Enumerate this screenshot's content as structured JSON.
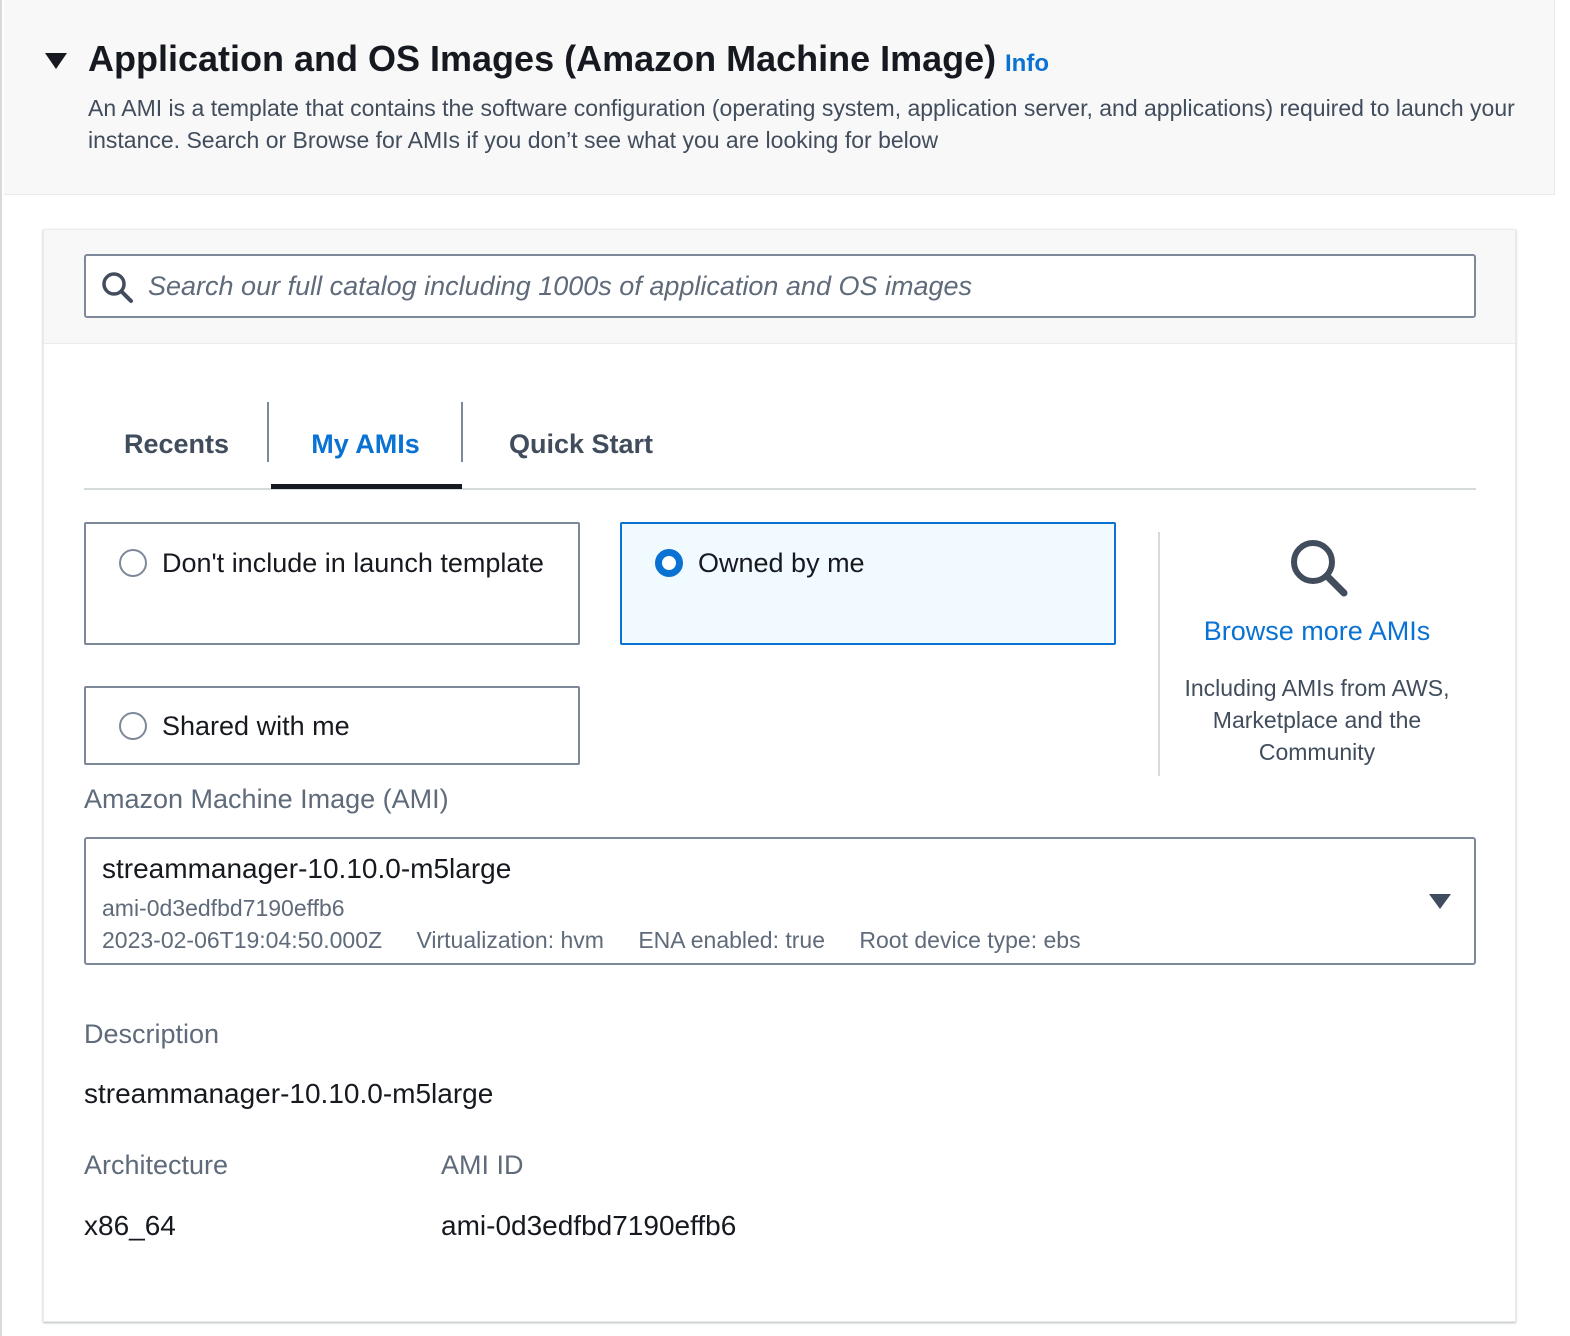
{
  "section": {
    "title": "Application and OS Images (Amazon Machine Image)",
    "info_label": "Info",
    "description": "An AMI is a template that contains the software configuration (operating system, application server, and applications) required to launch your instance. Search or Browse for AMIs if you don’t see what you are looking for below"
  },
  "search": {
    "placeholder": "Search our full catalog including 1000s of application and OS images",
    "value": ""
  },
  "tabs": [
    {
      "label": "Recents",
      "active": false
    },
    {
      "label": "My AMIs",
      "active": true
    },
    {
      "label": "Quick Start",
      "active": false
    }
  ],
  "ownership_options": [
    {
      "label": "Don't include in launch template",
      "checked": false
    },
    {
      "label": "Owned by me",
      "checked": true
    },
    {
      "label": "Shared with me",
      "checked": false
    }
  ],
  "browse": {
    "link_label": "Browse more AMIs",
    "subtext": "Including AMIs from AWS, Marketplace and the Community",
    "icon": "search-icon"
  },
  "ami_select": {
    "label": "Amazon Machine Image (AMI)",
    "selected_name": "streammanager-10.10.0-m5large",
    "selected_id": "ami-0d3edfbd7190effb6",
    "creation_date": "2023-02-06T19:04:50.000Z",
    "virtualization": "Virtualization: hvm",
    "ena": "ENA enabled: true",
    "root_device": "Root device type: ebs"
  },
  "details": {
    "description_label": "Description",
    "description_value": "streammanager-10.10.0-m5large",
    "architecture_label": "Architecture",
    "architecture_value": "x86_64",
    "ami_id_label": "AMI ID",
    "ami_id_value": "ami-0d3edfbd7190effb6"
  },
  "colors": {
    "link": "#0972d3",
    "selected_bg": "#f1faff",
    "text": "#16191f",
    "muted": "#5f6b7a"
  }
}
